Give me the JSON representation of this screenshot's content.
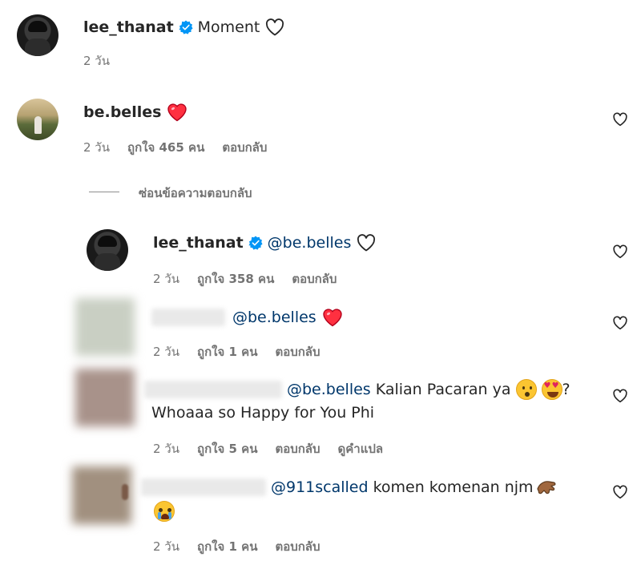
{
  "caption": {
    "username": "lee_thanat",
    "text": "Moment",
    "time": "2 วัน"
  },
  "comments": [
    {
      "username": "be.belles",
      "time": "2 วัน",
      "likes": "ถูกใจ 465 คน",
      "reply": "ตอบกลับ"
    }
  ],
  "hide_replies": "ซ่อนข้อความตอบกลับ",
  "replies": [
    {
      "username": "lee_thanat",
      "mention": "@be.belles",
      "time": "2 วัน",
      "likes": "ถูกใจ 358 คน",
      "reply": "ตอบกลับ"
    },
    {
      "mention": "@be.belles",
      "time": "2 วัน",
      "likes": "ถูกใจ 1 คน",
      "reply": "ตอบกลับ"
    },
    {
      "mention": "@be.belles",
      "text": "Kalian Pacaran ya",
      "text_end": "?",
      "text_line2": "Whoaaa so Happy for You Phi",
      "time": "2 วัน",
      "likes": "ถูกใจ 5 คน",
      "reply": "ตอบกลับ",
      "translate": "ดูคำแปล"
    },
    {
      "mention": "@911scalled",
      "text": "komen komenan njm",
      "time": "2 วัน",
      "likes": "ถูกใจ 1 คน",
      "reply": "ตอบกลับ"
    }
  ],
  "colors": {
    "text": "#262626",
    "muted": "#737373",
    "mention": "#00376b",
    "verified": "#0095f6",
    "heart_red": "#ff3040"
  },
  "icons": [
    "verified-badge-icon",
    "heart-outline-icon",
    "red-heart-icon",
    "like-heart-icon",
    "hushed-face-emoji",
    "heart-eyes-emoji",
    "crying-face-emoji",
    "pinching-hand-emoji"
  ]
}
